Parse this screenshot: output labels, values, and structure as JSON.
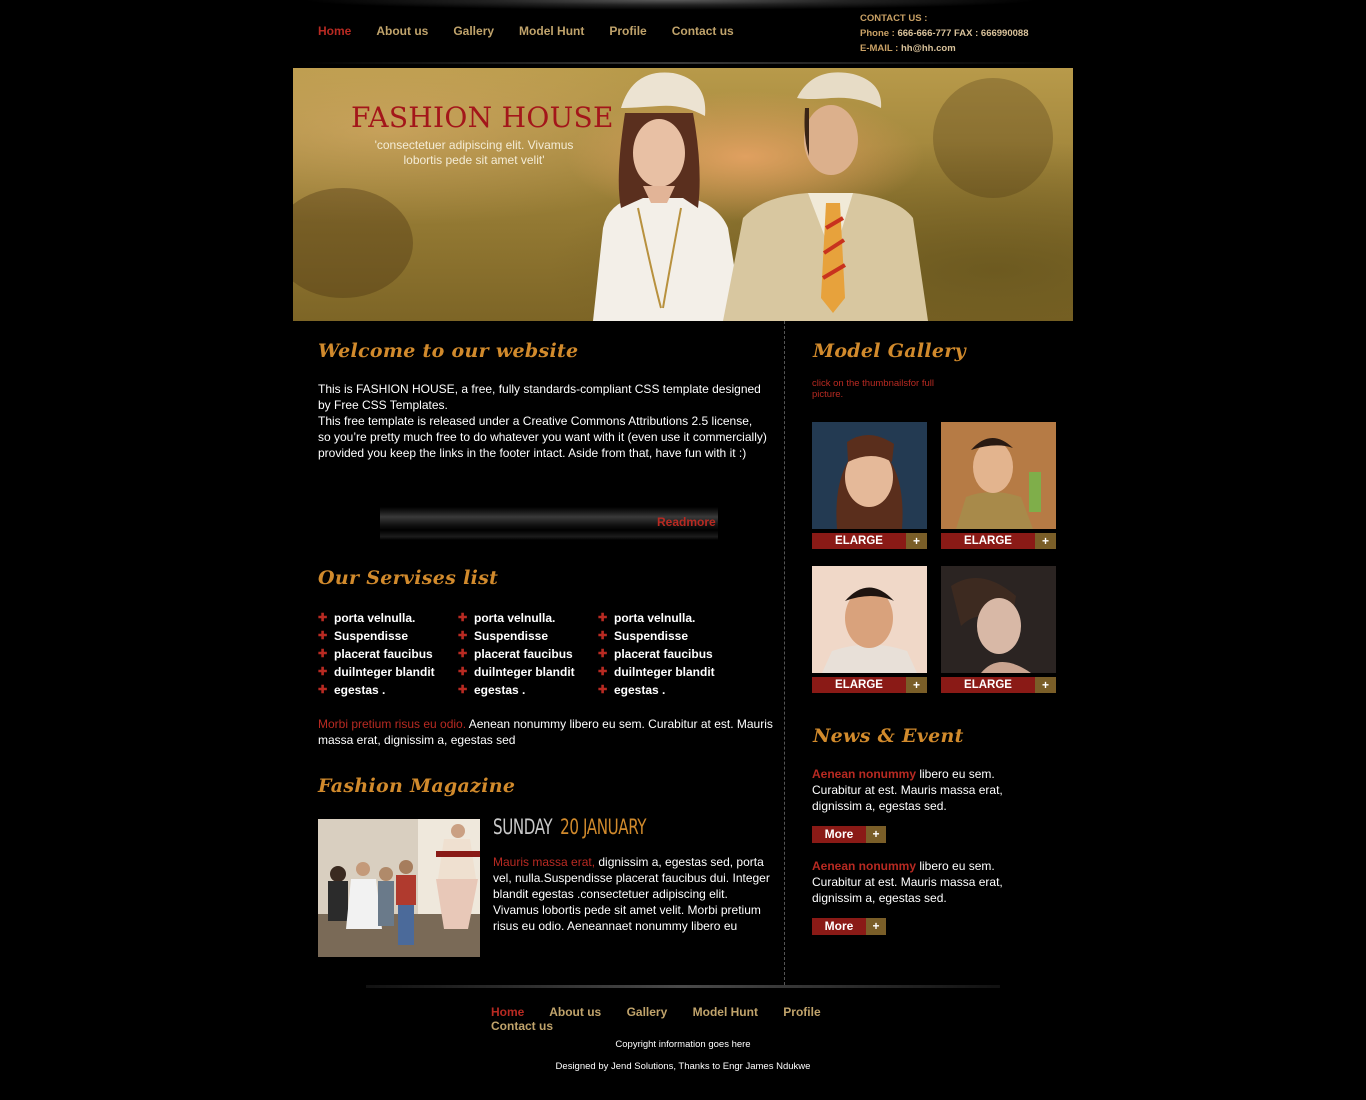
{
  "nav": {
    "items": [
      {
        "label": "Home",
        "active": true
      },
      {
        "label": "About us",
        "active": false
      },
      {
        "label": "Gallery",
        "active": false
      },
      {
        "label": "Model Hunt",
        "active": false
      },
      {
        "label": "Profile",
        "active": false
      },
      {
        "label": "Contact us",
        "active": false
      }
    ]
  },
  "contact": {
    "heading": "CONTACT US :",
    "phone_label": "Phone :",
    "phone_value": "666-666-777 FAX : 666990088",
    "email_label": "E-MAIL :",
    "email_value": "hh@hh.com"
  },
  "banner": {
    "title": "FASHION HOUSE",
    "subtitle": "'consectetuer adipiscing elit. Vivamus lobortis pede sit amet velit'"
  },
  "welcome": {
    "heading": "Welcome to our website",
    "paragraph1": "This is FASHION HOUSE, a free, fully standards-compliant CSS template designed by Free CSS Templates.",
    "paragraph2": "This free template is released under a Creative Commons Attributions 2.5 license, so you’re pretty much free to do whatever you want with it (even use it commercially) provided you keep the links in the footer intact. Aside from that, have fun with it :)",
    "readmore": "Readmore"
  },
  "services": {
    "heading": "Our Servises list",
    "columns": [
      [
        "porta velnulla.",
        "Suspendisse",
        "placerat faucibus",
        "duilnteger blandit",
        "egestas ."
      ],
      [
        "porta velnulla.",
        "Suspendisse",
        "placerat faucibus",
        "duilnteger blandit",
        "egestas ."
      ],
      [
        "porta velnulla.",
        "Suspendisse",
        "placerat faucibus",
        "duilnteger blandit",
        "egestas ."
      ]
    ],
    "bullet": "✚",
    "note_highlight": "Morbi pretium risus eu odio.",
    "note_text": " Aenean nonummy libero eu sem. Curabitur at est. Mauris massa erat, dignissim a, egestas sed"
  },
  "magazine": {
    "heading": "Fashion Magazine",
    "day": "SUNDAY",
    "date": "20 JANUARY",
    "highlight": "Mauris massa erat,",
    "text": " dignissim a, egestas sed, porta vel, nulla.Suspendisse placerat faucibus dui. Integer blandit egestas .consectetuer adipiscing elit. Vivamus lobortis pede sit amet velit. Morbi pretium risus eu odio. Aeneannaet nonummy libero eu"
  },
  "gallery": {
    "heading": "Model Gallery",
    "note": "click on the thumbnailsfor full picture.",
    "button_label": "ELARGE",
    "button_plus": "+"
  },
  "news": {
    "heading": "News & Event",
    "items": [
      {
        "highlight": "Aenean nonummy",
        "text": " libero eu sem. Curabitur at est. Mauris massa erat, dignissim a, egestas sed."
      },
      {
        "highlight": "Aenean nonummy",
        "text": " libero eu sem. Curabitur at est. Mauris massa erat, dignissim a, egestas sed."
      }
    ],
    "more_label": "More",
    "more_plus": "+"
  },
  "footer": {
    "copyright": "Copyright information goes here",
    "credits": "Designed by Jend Solutions, Thanks to Engr James Ndukwe"
  },
  "colors": {
    "accent_red": "#b82a22",
    "nav_gold": "#c0a36b",
    "heading_orange": "#d18a2c"
  }
}
